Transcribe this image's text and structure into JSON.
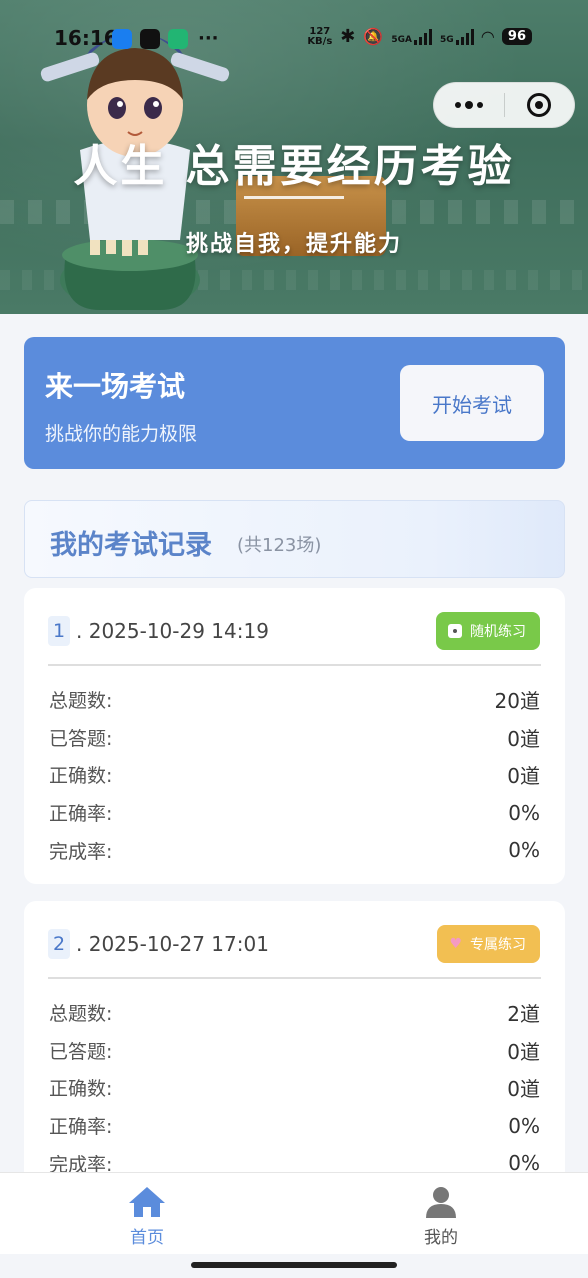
{
  "status_bar": {
    "time": "16:16",
    "more": "···",
    "net_speed_value": "127",
    "net_speed_unit": "KB/s",
    "net1": "5GA",
    "net2": "5G",
    "battery": "96"
  },
  "banner": {
    "title": "人生 总需要经历考验",
    "subtitle": "挑战自我，提升能力"
  },
  "exam_card": {
    "title": "来一场考试",
    "subtitle": "挑战你的能力极限",
    "button": "开始考试"
  },
  "records": {
    "title": "我的考试记录",
    "count": "(共123场)",
    "items": [
      {
        "index": "1",
        "date": ". 2025-10-29 14:19",
        "tag": "随机练习",
        "tag_color": "#79c949",
        "tag_icon": "dice-icon",
        "rows": [
          {
            "label": "总题数:",
            "value": "20道"
          },
          {
            "label": "已答题:",
            "value": "0道"
          },
          {
            "label": "正确数:",
            "value": "0道"
          },
          {
            "label": "正确率:",
            "value": "0%"
          },
          {
            "label": "完成率:",
            "value": "0%"
          }
        ]
      },
      {
        "index": "2",
        "date": ". 2025-10-27 17:01",
        "tag": "专属练习",
        "tag_color": "#f2bf52",
        "tag_icon": "heart-icon",
        "rows": [
          {
            "label": "总题数:",
            "value": "2道"
          },
          {
            "label": "已答题:",
            "value": "0道"
          },
          {
            "label": "正确数:",
            "value": "0道"
          },
          {
            "label": "正确率:",
            "value": "0%"
          },
          {
            "label": "完成率:",
            "value": "0%"
          }
        ]
      }
    ]
  },
  "tabbar": {
    "home": "首页",
    "mine": "我的",
    "active_color": "#5b8cdc"
  },
  "colors": {
    "primary": "#5b8cdc",
    "green_tag": "#79c949",
    "orange_tag": "#f2bf52"
  }
}
